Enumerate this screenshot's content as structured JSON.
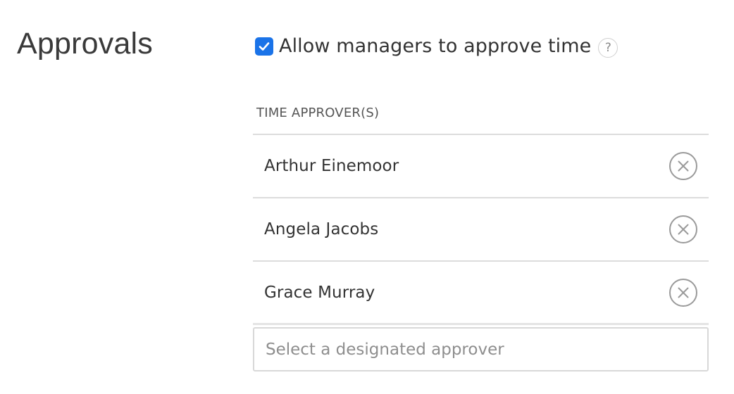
{
  "section": {
    "title": "Approvals"
  },
  "allow_managers": {
    "label": "Allow managers to approve time",
    "checked": true,
    "help_glyph": "?"
  },
  "approvers": {
    "header": "TIME APPROVER(S)",
    "items": [
      {
        "name": "Arthur Einemoor",
        "remove_icon": "close-circle-icon"
      },
      {
        "name": "Angela Jacobs",
        "remove_icon": "close-circle-icon"
      },
      {
        "name": "Grace Murray",
        "remove_icon": "close-circle-icon"
      }
    ]
  },
  "approver_select": {
    "value": "",
    "placeholder": "Select a designated approver"
  },
  "colors": {
    "checkbox": "#1a73e8",
    "divider": "#dcdcdc",
    "remove_icon": "#9a9a9a"
  }
}
